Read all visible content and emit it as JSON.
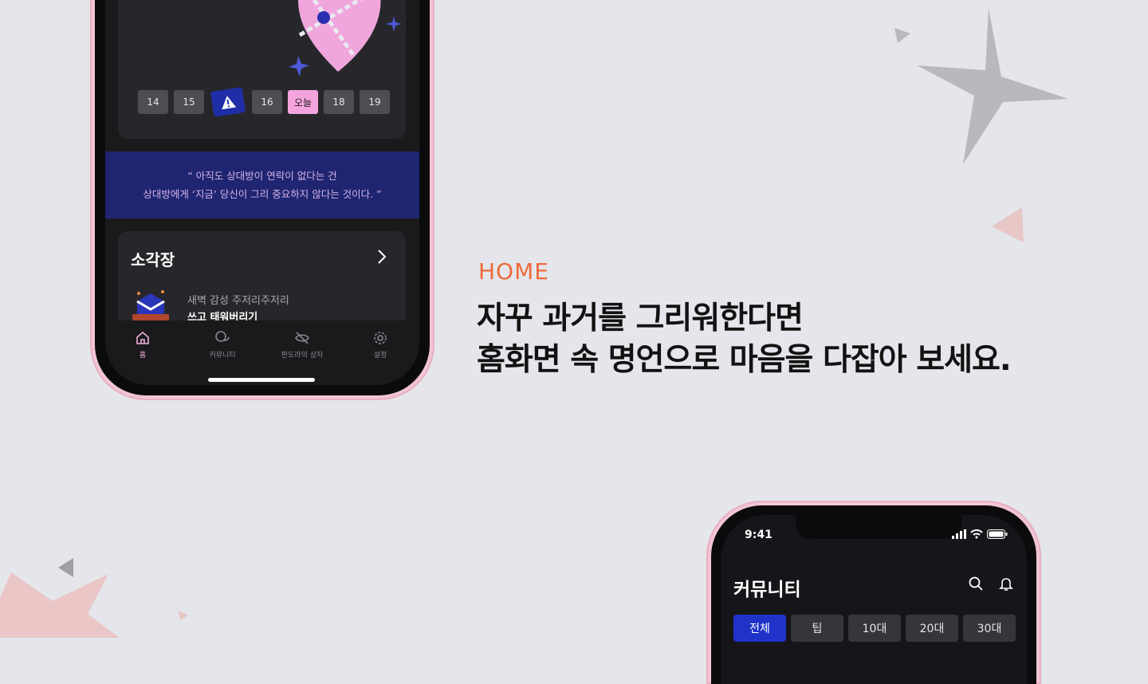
{
  "colors": {
    "background": "#e4e6eb",
    "accent_orange": "#ee6a3b",
    "accent_pink": "#f3a4dd",
    "accent_blue": "#1f33c9",
    "quote_banner": "#1f2570",
    "phone_frame": "#f2c5d4"
  },
  "section": {
    "eyebrow": "HOME",
    "headline_line1": "자꾸 과거를 그리워한다면",
    "headline_line2": "홈화면 속 명언으로 마음을 다잡아 보세요."
  },
  "home_screen": {
    "calendar": {
      "days": [
        "14",
        "15",
        "16",
        "오늘",
        "18",
        "19"
      ],
      "warning_icon": "warning-icon"
    },
    "quote": {
      "line1": "“ 아직도 상대방이 연락이 없다는 건",
      "line2": "상대방에게 ‘지금’ 당신이 그리 중요하지 않다는 것이다. ”"
    },
    "burn_card": {
      "title": "소각장",
      "subtitle": "새벽 감성 주저리주저리",
      "main": "쓰고 태워버리기",
      "arrow_icon": "chevron-right-icon"
    },
    "tab_bar": [
      {
        "label": "홈",
        "icon": "home-icon",
        "active": true
      },
      {
        "label": "커뮤니티",
        "icon": "chat-icon",
        "active": false
      },
      {
        "label": "판도라의 상자",
        "icon": "eye-off-icon",
        "active": false
      },
      {
        "label": "설정",
        "icon": "gear-icon",
        "active": false
      }
    ]
  },
  "community_screen": {
    "status_time": "9:41",
    "title": "커뮤니티",
    "icons": [
      "search-icon",
      "bell-icon"
    ],
    "filters": [
      "전체",
      "팁",
      "10대",
      "20대",
      "30대"
    ],
    "active_filter": "전체"
  }
}
